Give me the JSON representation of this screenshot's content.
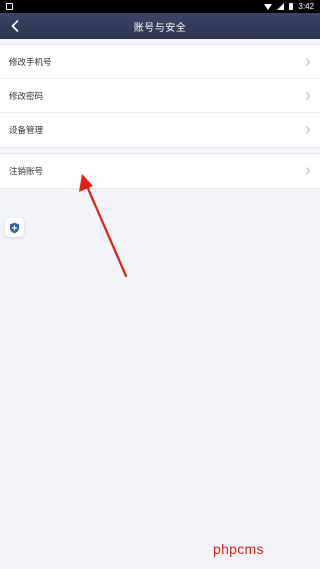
{
  "status_bar": {
    "time": "3:42",
    "icons": [
      "app-notification-icon",
      "wifi-icon",
      "cell-signal-icon",
      "battery-icon"
    ]
  },
  "nav": {
    "back_icon": "chevron-left-icon",
    "title": "账号与安全"
  },
  "sections": [
    {
      "items": [
        {
          "label": "修改手机号"
        },
        {
          "label": "修改密码"
        },
        {
          "label": "设备管理"
        }
      ]
    },
    {
      "items": [
        {
          "label": "注销账号"
        }
      ]
    }
  ],
  "floating_button": {
    "icon": "shield-plus-icon"
  },
  "annotation": {
    "type": "red-arrow",
    "points_to": "注销账号"
  },
  "watermark": "phpcms",
  "colors": {
    "nav_bg": "#2f3856",
    "page_bg": "#f3f4f7",
    "accent_icon": "#2f5fa8",
    "arrow": "#e0201a"
  }
}
